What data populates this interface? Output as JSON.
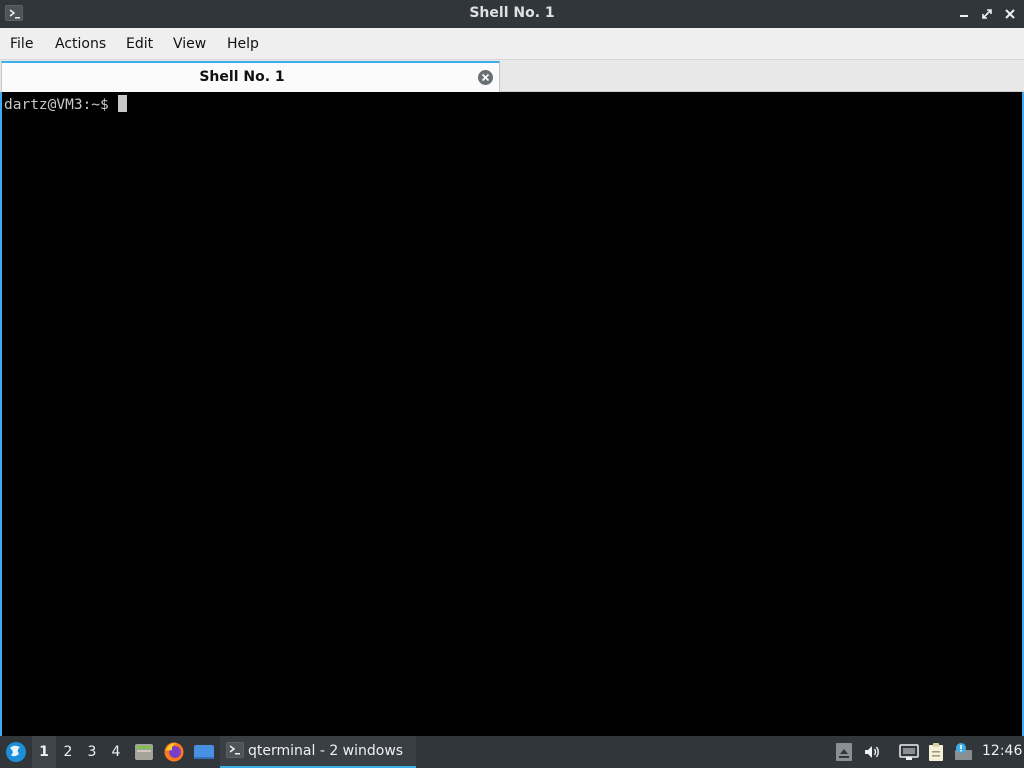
{
  "window": {
    "title": "Shell No. 1"
  },
  "menu": {
    "items": [
      "File",
      "Actions",
      "Edit",
      "View",
      "Help"
    ]
  },
  "tabs": [
    {
      "label": "Shell No. 1",
      "active": true
    }
  ],
  "terminal": {
    "prompt": "dartz@VM3:~$"
  },
  "taskbar": {
    "desktops": [
      "1",
      "2",
      "3",
      "4"
    ],
    "active_desktop": "1",
    "task_label": "qterminal - 2 windows",
    "clock": "12:46"
  },
  "colors": {
    "accent": "#3daee9",
    "titlebar": "#31363b",
    "terminal_bg": "#000000",
    "terminal_fg": "#c8c8c8"
  },
  "icons": {
    "app": "terminal-icon",
    "start": "lxqt-start-icon",
    "launchers": [
      "file-manager-icon",
      "firefox-icon",
      "show-desktop-icon"
    ],
    "tray": [
      "tray-arrow-icon",
      "volume-icon",
      "network-icon",
      "clipboard-icon",
      "update-notifier-icon"
    ]
  }
}
